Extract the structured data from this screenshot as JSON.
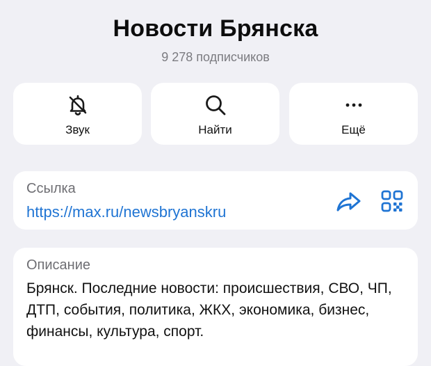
{
  "channel": {
    "title": "Новости Брянска",
    "subscribers": "9 278 подписчиков"
  },
  "actions": [
    {
      "label": "Звук",
      "icon": "bell-off-icon"
    },
    {
      "label": "Найти",
      "icon": "search-icon"
    },
    {
      "label": "Ещё",
      "icon": "more-icon"
    }
  ],
  "link": {
    "label": "Ссылка",
    "url": "https://max.ru/newsbryanskru",
    "share_icon": "share-icon",
    "qr_icon": "qr-code-icon"
  },
  "description": {
    "label": "Описание",
    "text": "Брянск. Последние новости: происшествия, СВО, ЧП, ДТП, события, политика, ЖКХ, экономика, бизнес, финансы, культура, спорт."
  },
  "colors": {
    "background": "#f0f0f5",
    "card": "#ffffff",
    "accent": "#1f74d3",
    "secondary_text": "#7b7b80"
  }
}
